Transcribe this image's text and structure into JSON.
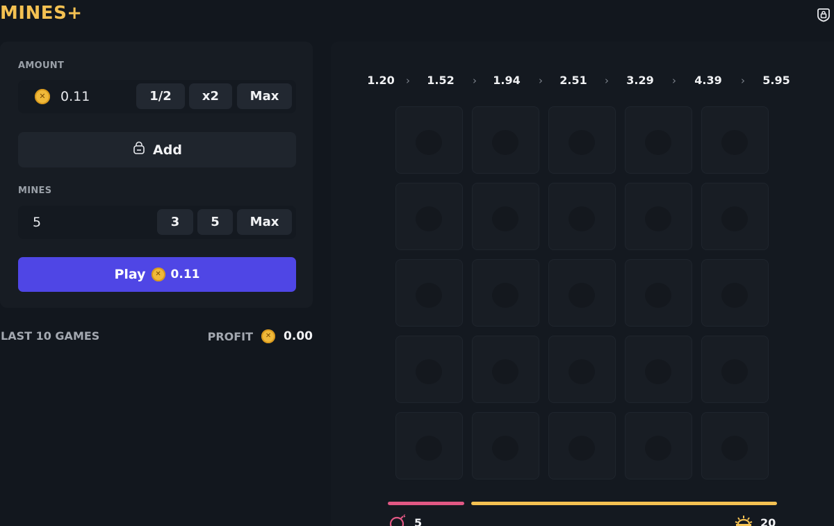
{
  "app": {
    "logo": "MINES+"
  },
  "header": {
    "lock_icon": "lock-icon"
  },
  "bet_panel": {
    "amount_label": "AMOUNT",
    "amount_value": "0.11",
    "amount_buttons": [
      "1/2",
      "x2",
      "Max"
    ],
    "add_label": "Add",
    "mines_label": "MINES",
    "mines_value": "5",
    "mines_buttons": [
      "3",
      "5",
      "Max"
    ],
    "play_label": "Play",
    "play_amount": "0.11"
  },
  "history": {
    "last_games_label": "LAST 10 GAMES",
    "profit_label": "PROFIT",
    "profit_value": "0.00"
  },
  "board": {
    "multipliers": [
      "1.20",
      "1.52",
      "1.94",
      "2.51",
      "3.29",
      "4.39",
      "5.95"
    ],
    "rows": 5,
    "cols": 5,
    "mines_count": "5",
    "gems_count": "20"
  },
  "colors": {
    "accent": "#4f46e5",
    "brand": "#f4c152",
    "mines_bar": "#e15884",
    "gems_bar": "#f4c152"
  }
}
